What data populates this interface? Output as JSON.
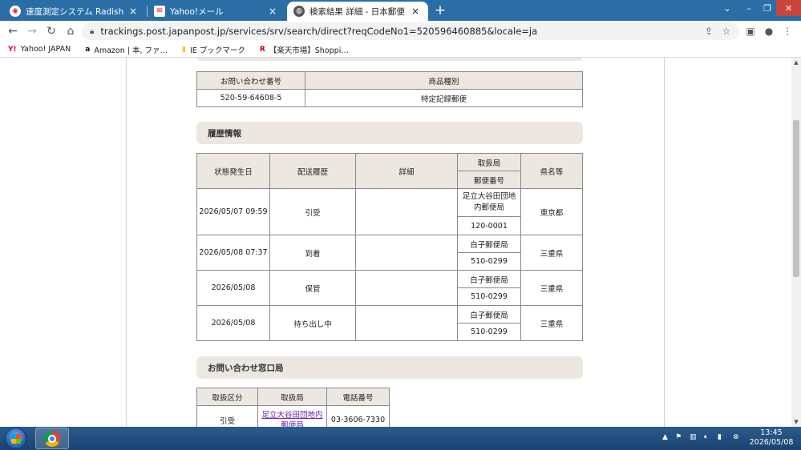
{
  "browser": {
    "tabs": [
      {
        "title": "速度測定システム Radish Netwo",
        "close": "×",
        "active": false
      },
      {
        "title": "Yahoo!メール",
        "close": "×",
        "active": false
      },
      {
        "title": "検索結果 詳細 - 日本郵便",
        "close": "×",
        "active": true
      }
    ],
    "new_tab": "+",
    "window_controls": {
      "menu": "⌄",
      "minimize": "–",
      "maximize": "❐",
      "close": "✕"
    },
    "url": "trackings.post.japanpost.jp/services/srv/search/direct?reqCodeNo1=520596460885&locale=ja",
    "bookmarks": [
      {
        "icon": "Y!",
        "label": "Yahoo! JAPAN"
      },
      {
        "icon": "a",
        "label": "Amazon | 本, ファ…"
      },
      {
        "icon": "▮",
        "label": "IE ブックマーク"
      },
      {
        "icon": "R",
        "label": "【楽天市場】Shoppi…"
      }
    ]
  },
  "summary_table": {
    "headers": [
      "お問い合わせ番号",
      "商品種別"
    ],
    "row": [
      "520-59-64608-5",
      "特定記録郵便"
    ]
  },
  "history": {
    "title": "履歴情報",
    "headers": {
      "date": "状態発生日",
      "status": "配送履歴",
      "detail": "詳細",
      "office": "取扱局",
      "postal": "郵便番号",
      "pref": "県名等"
    },
    "rows": [
      {
        "date": "2026/05/07 09:59",
        "status": "引受",
        "detail": "",
        "office": "足立大谷田団地内郵便局",
        "postal": "120-0001",
        "pref": "東京都"
      },
      {
        "date": "2026/05/08 07:37",
        "status": "到着",
        "detail": "",
        "office": "白子郵便局",
        "postal": "510-0299",
        "pref": "三重県"
      },
      {
        "date": "2026/05/08",
        "status": "保管",
        "detail": "",
        "office": "白子郵便局",
        "postal": "510-0299",
        "pref": "三重県"
      },
      {
        "date": "2026/05/08",
        "status": "持ち出し中",
        "detail": "",
        "office": "白子郵便局",
        "postal": "510-0299",
        "pref": "三重県"
      }
    ]
  },
  "contact": {
    "title": "お問い合わせ窓口局",
    "headers": [
      "取扱区分",
      "取扱局",
      "電話番号"
    ],
    "row": {
      "type": "引受",
      "office": "足立大谷田団地内郵便局",
      "phone": "03-3606-7330"
    }
  },
  "taskbar": {
    "clock_time": "13:45",
    "clock_date": "2026/05/08"
  }
}
